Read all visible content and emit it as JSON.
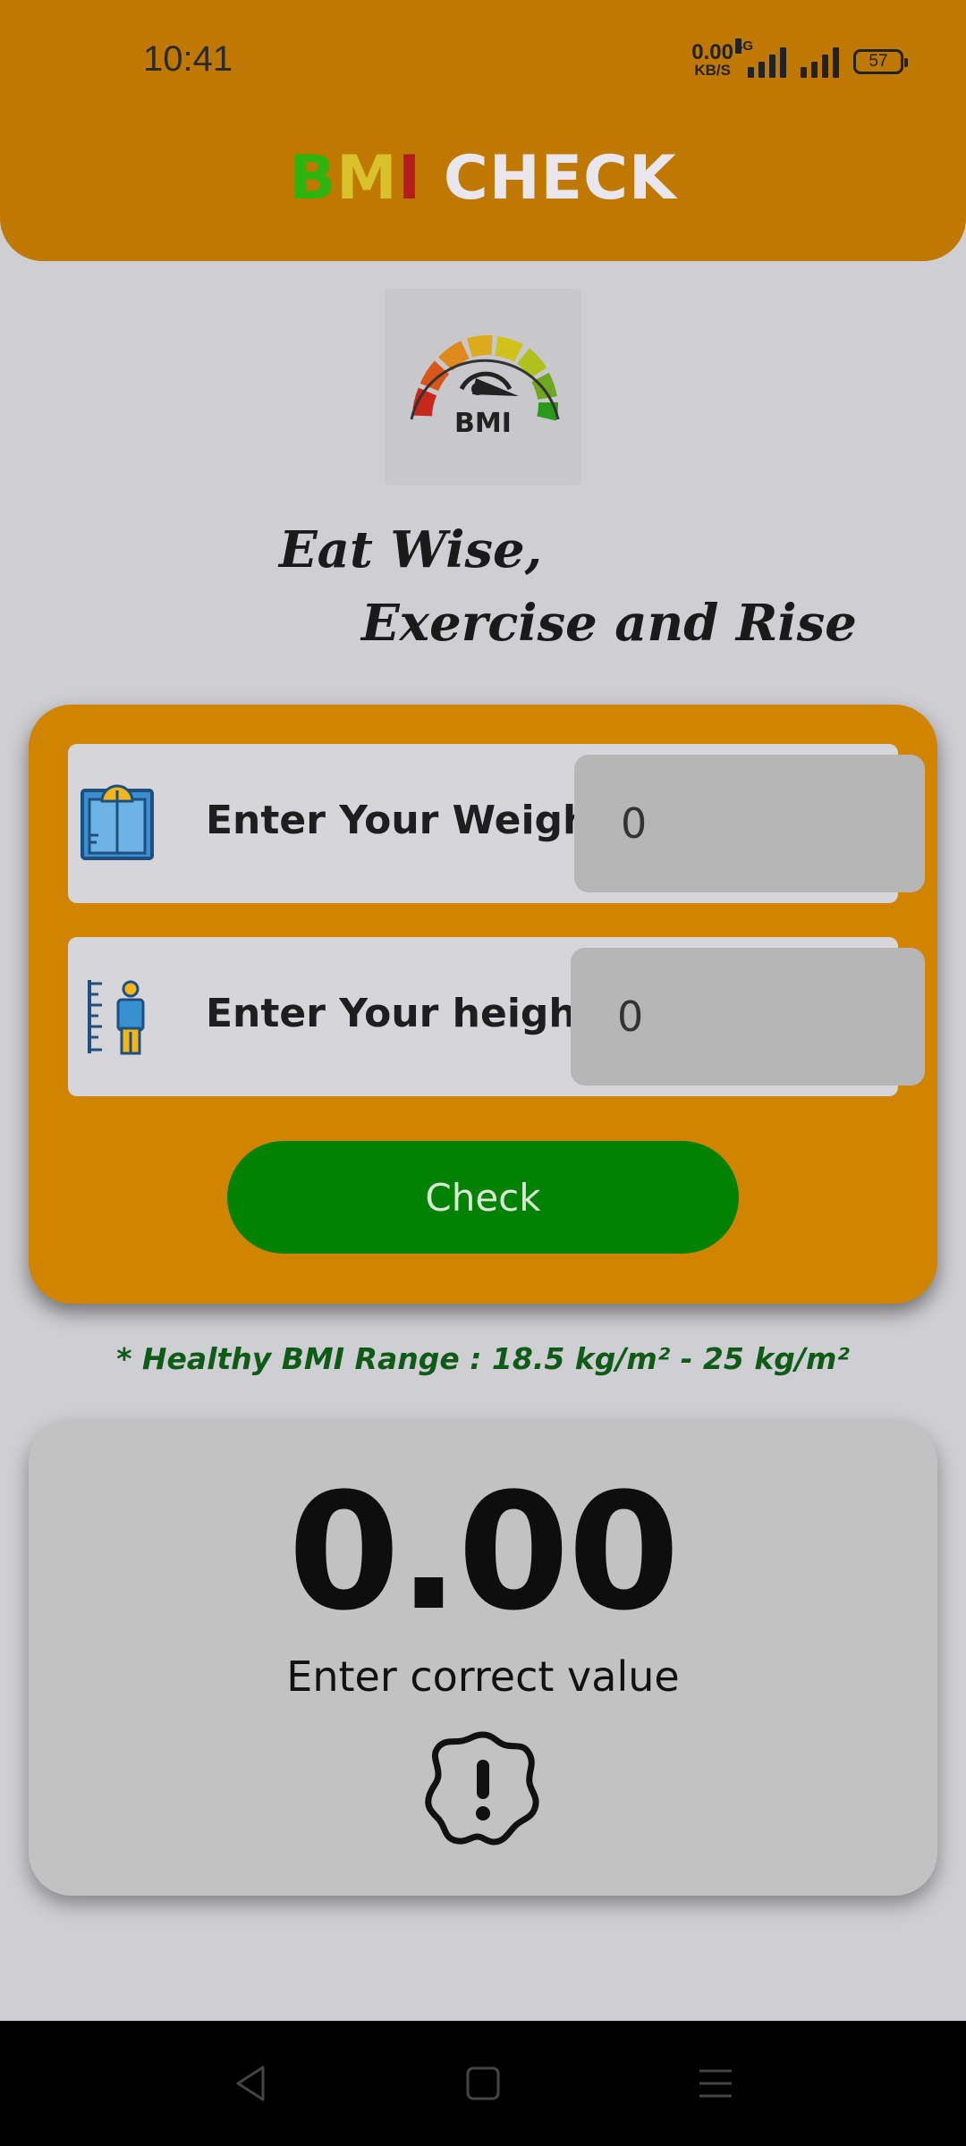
{
  "status_bar": {
    "time": "10:41",
    "net_speed_value": "0.00",
    "net_speed_unit": "KB/S",
    "network_type": "4G",
    "battery": "57"
  },
  "header": {
    "title_b": "B",
    "title_m": "M",
    "title_i": "I",
    "title_rest": " CHECK",
    "colors": {
      "background": "#bf7800",
      "b": "#2db40e",
      "m": "#d8c12a",
      "i": "#b51d1d"
    }
  },
  "logo": {
    "text": "BMI"
  },
  "slogan": {
    "line1": "Eat Wise,",
    "line2": "Exercise and Rise"
  },
  "form": {
    "weight_label": "Enter Your Weight :",
    "weight_value": "0",
    "height_label": "Enter Your height  :",
    "height_value": "0",
    "check_label": "Check",
    "colors": {
      "card": "#d08400",
      "button": "#028202"
    }
  },
  "healthy_range": "* Healthy BMI Range : 18.5 kg/m² - 25 kg/m²",
  "result": {
    "value": "0.00",
    "message": "Enter correct value",
    "icon": "alert-badge-icon"
  },
  "nav": {
    "icons": [
      "back-icon",
      "home-icon",
      "recents-icon"
    ]
  }
}
